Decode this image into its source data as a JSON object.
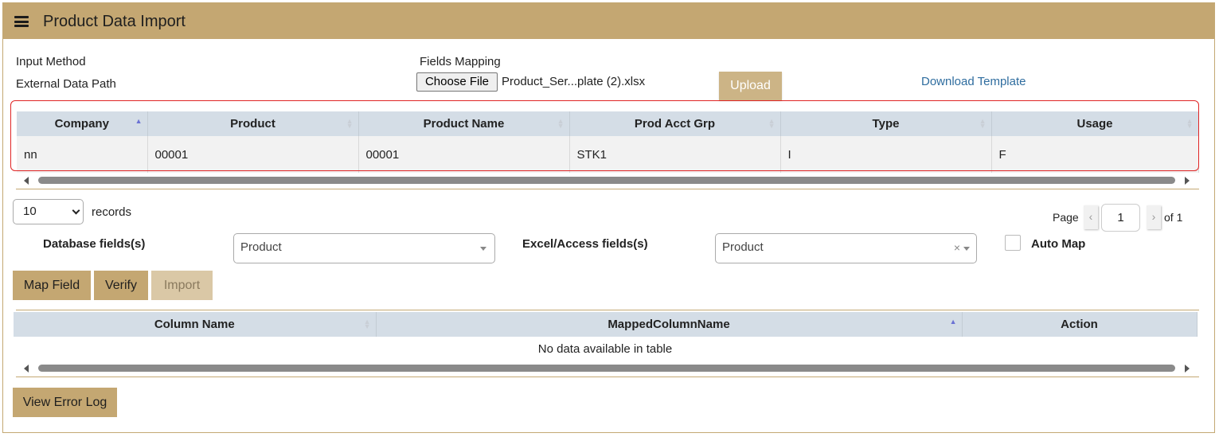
{
  "header": {
    "title": "Product Data Import",
    "menu_icon": "hamburger-icon"
  },
  "form": {
    "input_method_label": "Input Method",
    "external_path_label": "External Data Path",
    "fields_mapping_label": "Fields Mapping",
    "choose_file_label": "Choose File",
    "file_name": "Product_Ser...plate (2).xlsx",
    "upload_label": "Upload",
    "download_template_label": "Download Template"
  },
  "preview_table": {
    "columns": [
      "Company",
      "Product",
      "Product Name",
      "Prod Acct Grp",
      "Type",
      "Usage"
    ],
    "rows": [
      [
        "nn",
        "00001",
        "00001",
        "STK1",
        "I",
        "F"
      ]
    ]
  },
  "records": {
    "value": "10",
    "label": "records"
  },
  "pager": {
    "page_label": "Page",
    "current": "1",
    "of_label": "of 1",
    "prev": "‹",
    "next": "›"
  },
  "mapping": {
    "db_fields_label": "Database fields(s)",
    "db_field_value": "Product",
    "excel_fields_label": "Excel/Access fields(s)",
    "excel_field_value": "Product",
    "clear_glyph": "×",
    "auto_map_label": "Auto Map"
  },
  "actions": {
    "map_field": "Map Field",
    "verify": "Verify",
    "import": "Import"
  },
  "mapped_table": {
    "columns": [
      "Column Name",
      "MappedColumnName",
      "Action"
    ],
    "empty_text": "No data available in table"
  },
  "footer": {
    "view_error_log": "View Error Log"
  },
  "colors": {
    "header_bg": "#c4a772",
    "highlight_border": "#e02424",
    "link": "#2f6d9f"
  }
}
